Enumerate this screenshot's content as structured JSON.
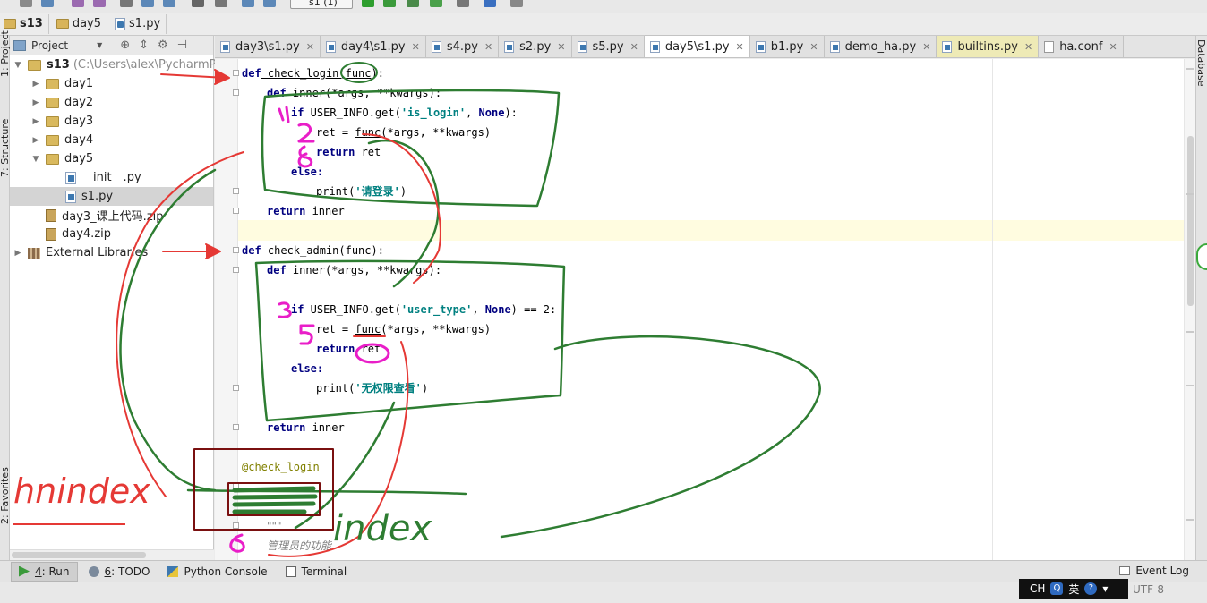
{
  "toolbar": {
    "run_config": "s1 (1)"
  },
  "breadcrumb": {
    "items": [
      "s13",
      "day5",
      "s1.py"
    ]
  },
  "side_tools": {
    "project": "1: Project",
    "structure": "7: Structure",
    "favorites": "2: Favorites",
    "database": "Database"
  },
  "project_panel": {
    "header": "Project",
    "root": {
      "name": "s13",
      "path": "(C:\\Users\\alex\\PycharmProje"
    },
    "items": [
      {
        "name": "day1",
        "type": "folder"
      },
      {
        "name": "day2",
        "type": "folder"
      },
      {
        "name": "day3",
        "type": "folder"
      },
      {
        "name": "day4",
        "type": "folder"
      },
      {
        "name": "day5",
        "type": "folder-open"
      },
      {
        "name": "__init__.py",
        "type": "py"
      },
      {
        "name": "s1.py",
        "type": "py",
        "selected": true
      },
      {
        "name": "day3_课上代码.zip",
        "type": "zip"
      },
      {
        "name": "day4.zip",
        "type": "zip"
      },
      {
        "name": "External Libraries",
        "type": "lib"
      }
    ]
  },
  "tabs": [
    {
      "label": "day3\\s1.py"
    },
    {
      "label": "day4\\s1.py"
    },
    {
      "label": "s4.py"
    },
    {
      "label": "s2.py"
    },
    {
      "label": "s5.py"
    },
    {
      "label": "day5\\s1.py",
      "active": true
    },
    {
      "label": "b1.py"
    },
    {
      "label": "demo_ha.py"
    },
    {
      "label": "builtins.py"
    },
    {
      "label": "ha.conf"
    }
  ],
  "code": {
    "l1_def": "def",
    "l1_name": " check_login(",
    "l1_arg": "func",
    "l1_end": "):",
    "l2": "def",
    "l2b": " inner(*args, **kwargs):",
    "l3a": "if",
    "l3b": " USER_INFO.get(",
    "l3c": "'is_login'",
    "l3d": ", ",
    "l3e": "None",
    "l3f": "):",
    "l4a": "ret = ",
    "l4b": "func",
    "l4c": "(*args, **kwargs)",
    "l5a": "return",
    "l5b": " ret",
    "l6": "else:",
    "l7a": "print(",
    "l7b": "'请登录'",
    "l7c": ")",
    "l8a": "return",
    "l8b": " inner",
    "l9a": "def",
    "l9b": " check_admin(func):",
    "l10a": "def",
    "l10b": " inner(*args, **kwargs):",
    "l11a": "if",
    "l11b": " USER_INFO.get(",
    "l11c": "'user_type'",
    "l11d": ", ",
    "l11e": "None",
    "l11f": ") == 2:",
    "l12a": "ret = ",
    "l12b": "func",
    "l12c": "(*args, **kwargs)",
    "l13a": "return",
    "l13b": " ret",
    "l14": "else:",
    "l15a": "print(",
    "l15b": "'无权限查看'",
    "l15c": ")",
    "l16a": "return",
    "l16b": " inner",
    "l17": "@check_login",
    "l18": "\"\"\"",
    "l19": "管理员的功能"
  },
  "bottom_tools": [
    {
      "num": "4",
      "label": ": Run",
      "active": true
    },
    {
      "num": "6",
      "label": ": TODO"
    },
    {
      "num": "",
      "label": "Python Console"
    },
    {
      "num": "",
      "label": "Terminal"
    }
  ],
  "event_log": "Event Log",
  "status": {
    "ime_lang": "CH",
    "ime_mode": "英",
    "encoding": "UTF-8"
  },
  "handwriting": [
    "hnindex",
    "index"
  ],
  "annotation_colors": {
    "green": "#2E7D32",
    "red": "#E53935",
    "magenta": "#E91EC8",
    "maroon": "#7A1010"
  }
}
